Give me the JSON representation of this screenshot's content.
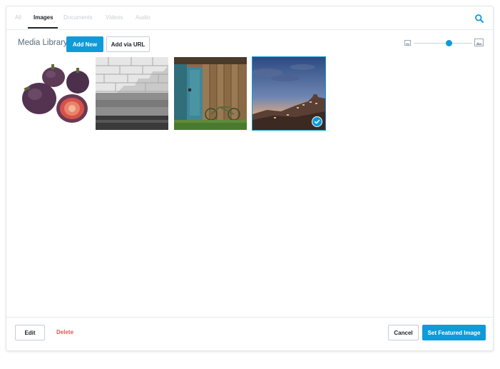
{
  "tabs": [
    {
      "label": "All",
      "active": false
    },
    {
      "label": "Images",
      "active": true
    },
    {
      "label": "Documents",
      "active": false
    },
    {
      "label": "Videos",
      "active": false
    },
    {
      "label": "Audio",
      "active": false
    }
  ],
  "search": {
    "icon": "search-icon"
  },
  "toolbar": {
    "title": "Media Library",
    "add_new_label": "Add New",
    "add_via_url_label": "Add via URL"
  },
  "zoom": {
    "small_icon": "image-small-icon",
    "large_icon": "image-large-icon",
    "level": 0.6
  },
  "media": [
    {
      "name": "figs",
      "selected": false
    },
    {
      "name": "stone-wall",
      "selected": false
    },
    {
      "name": "wooden-door-bicycle",
      "selected": false
    },
    {
      "name": "hilltop-town-sunset",
      "selected": true
    }
  ],
  "footer": {
    "edit_label": "Edit",
    "delete_label": "Delete",
    "cancel_label": "Cancel",
    "set_featured_label": "Set Featured Image"
  },
  "colors": {
    "accent": "#0f9bd7",
    "danger": "#e2574c"
  }
}
